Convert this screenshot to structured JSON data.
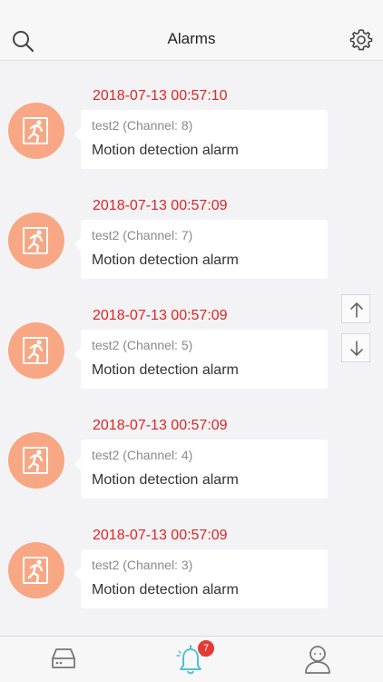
{
  "header": {
    "title": "Alarms"
  },
  "alarms": [
    {
      "time": "2018-07-13 00:57:10",
      "device": "test2 (Channel: 8)",
      "message": "Motion detection alarm"
    },
    {
      "time": "2018-07-13 00:57:09",
      "device": "test2 (Channel: 7)",
      "message": "Motion detection alarm"
    },
    {
      "time": "2018-07-13 00:57:09",
      "device": "test2 (Channel: 5)",
      "message": "Motion detection alarm"
    },
    {
      "time": "2018-07-13 00:57:09",
      "device": "test2 (Channel: 4)",
      "message": "Motion detection alarm"
    },
    {
      "time": "2018-07-13 00:57:09",
      "device": "test2 (Channel: 3)",
      "message": "Motion detection alarm"
    }
  ],
  "tabbar": {
    "alarms_badge": "7"
  },
  "icons": {
    "search": "search-icon",
    "settings": "gear-icon",
    "alarm_type": "running-person-icon",
    "scroll_up": "arrow-up-icon",
    "scroll_down": "arrow-down-icon",
    "devices_tab": "device-icon",
    "alarms_tab": "bell-icon",
    "profile_tab": "user-icon"
  },
  "colors": {
    "accent": "#4ec3d1",
    "alarm_time": "#e02424",
    "avatar": "#f7a783",
    "badge": "#e53935"
  }
}
